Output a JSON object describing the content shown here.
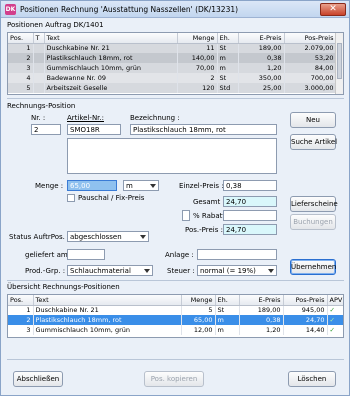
{
  "window": {
    "title": "Positionen Rechnung 'Ausstattung Nasszellen' (DK/13231)",
    "app_icon": "DK",
    "close": "✕"
  },
  "top_section": {
    "label": "Positionen Auftrag DK/1401",
    "columns": [
      "Pos.",
      "T",
      "Text",
      "Menge",
      "Eh.",
      "E-Preis",
      "Pos-Preis"
    ],
    "rows": [
      {
        "pos": "1",
        "t": "",
        "text": "Duschkabine Nr. 21",
        "menge": "11",
        "eh": "St",
        "epreis": "189,00",
        "pospreis": "2.079,00"
      },
      {
        "pos": "2",
        "t": "",
        "text": "Plastikschlauch 18mm, rot",
        "menge": "140,00",
        "eh": "m",
        "epreis": "0,38",
        "pospreis": "53,20"
      },
      {
        "pos": "3",
        "t": "",
        "text": "Gummischlauch 10mm, grün",
        "menge": "70,00",
        "eh": "m",
        "epreis": "1,20",
        "pospreis": "84,00"
      },
      {
        "pos": "4",
        "t": "",
        "text": "Badewanne Nr. 09",
        "menge": "2",
        "eh": "St",
        "epreis": "350,00",
        "pospreis": "700,00"
      },
      {
        "pos": "5",
        "t": "",
        "text": "Arbeitszeit Geselle",
        "menge": "120",
        "eh": "Std",
        "epreis": "25,00",
        "pospreis": "3.000,00"
      }
    ]
  },
  "position_section": {
    "label": "Rechnungs-Position",
    "nr_label": "Nr. :",
    "nr_value": "2",
    "artikel_label": "Artikel-Nr.:",
    "artikel_value": "SMO18R",
    "bezeichnung_label": "Bezeichnung :",
    "bezeichnung_value": "Plastikschlauch 18mm, rot",
    "menge_label": "Menge :",
    "menge_value": "65,00",
    "einheit_value": "m",
    "pauschal_label": "Pauschal / Fix-Preis",
    "einzelpreis_label": "Einzel-Preis :",
    "einzelpreis_value": "0,38",
    "gesamt_label": "Gesamt :",
    "gesamt_value": "24,70",
    "rabatt_label": "% Rabatt",
    "rabatt_value": "",
    "pospreis_label": "Pos.-Preis :",
    "pospreis_value": "24,70",
    "status_label": "Status AuftrPos.",
    "status_value": "abgeschlossen",
    "geliefert_label": "geliefert am :",
    "geliefert_value": "",
    "anlage_label": "Anlage :",
    "anlage_value": "",
    "prodgrp_label": "Prod.-Grp. :",
    "prodgrp_value": "Schlauchmaterial",
    "steuer_label": "Steuer :",
    "steuer_value": "normal (= 19%)"
  },
  "buttons": {
    "neu": "Neu",
    "suche_artikel": "Suche Artikel",
    "lieferscheine": "Lieferscheine",
    "buchungen": "Buchungen",
    "uebernehmen": "Übernehmen",
    "abschliessen": "Abschließen",
    "pos_kopieren": "Pos. kopieren",
    "loeschen": "Löschen"
  },
  "bottom_section": {
    "label": "Übersicht Rechnungs-Positionen",
    "columns": [
      "Pos.",
      "Text",
      "Menge",
      "Eh.",
      "E-Preis",
      "Pos-Preis",
      "APV"
    ],
    "rows": [
      {
        "pos": "1",
        "text": "Duschkabine Nr. 21",
        "menge": "5",
        "eh": "St",
        "epreis": "189,00",
        "pospreis": "945,00",
        "apv": "✓"
      },
      {
        "pos": "2",
        "text": "Plastikschlauch 18mm, rot",
        "menge": "65,00",
        "eh": "m",
        "epreis": "0,38",
        "pospreis": "24,70",
        "apv": "✓"
      },
      {
        "pos": "3",
        "text": "Gummischlauch 10mm, grün",
        "menge": "12,00",
        "eh": "m",
        "epreis": "1,20",
        "pospreis": "14,40",
        "apv": "✓"
      }
    ]
  },
  "colors": {
    "window_bg": "#eaf0f8",
    "selection_blue": "#3a8ee8",
    "highlight_cyan": "#d9f7fb",
    "check_green": "#2f9b2f"
  }
}
